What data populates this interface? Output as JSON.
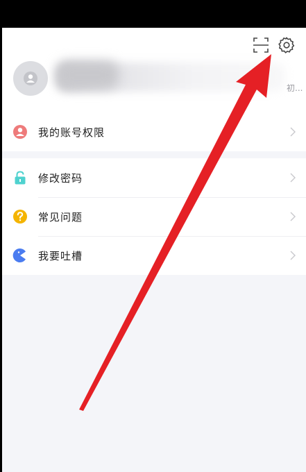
{
  "header": {
    "scan_icon": "scan-icon",
    "settings_icon": "gear-icon",
    "truncated_text": "初..."
  },
  "menu": {
    "account": {
      "label": "我的账号权限",
      "icon": "person-icon",
      "color": "#ee7b7b"
    },
    "items": [
      {
        "label": "修改密码",
        "icon": "lock-icon",
        "color": "#4fd2cf"
      },
      {
        "label": "常见问题",
        "icon": "question-icon",
        "color": "#f4b400"
      },
      {
        "label": "我要吐槽",
        "icon": "chomp-icon",
        "color": "#4a7cf0"
      }
    ]
  },
  "colors": {
    "arrow": "#e52025",
    "background": "#f4f5f9"
  }
}
